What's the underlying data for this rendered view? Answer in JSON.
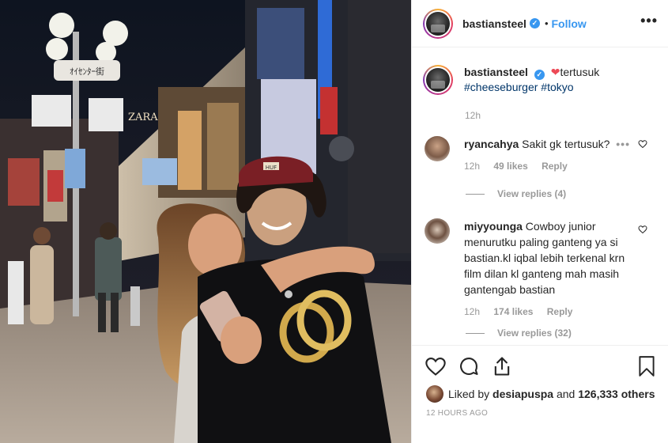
{
  "post": {
    "username": "bastiansteel",
    "verified_mark": "✓",
    "dot": "•",
    "follow_label": "Follow",
    "more_label": "•••"
  },
  "caption": {
    "username": "bastiansteel",
    "heart": "❤",
    "text": "tertusuk",
    "hashtag1": "#cheeseburger",
    "hashtag2": "#tokyo",
    "time": "12h"
  },
  "comments": [
    {
      "username": "ryancahya",
      "text": "Sakit gk tertusuk?",
      "time": "12h",
      "likes": "49 likes",
      "reply": "Reply",
      "view_replies": "View replies (4)"
    },
    {
      "username": "miyyounga",
      "text": "Cowboy junior menurutku paling ganteng ya si bastian.kl iqbal lebih terkenal krn film dilan kl ganteng mah masih gantengab bastian",
      "time": "12h",
      "likes": "174 likes",
      "reply": "Reply",
      "view_replies": "View replies (32)"
    }
  ],
  "footer": {
    "liked_prefix": "Liked by",
    "liked_user": "desiapuspa",
    "liked_and": "and",
    "liked_count": "126,333 others",
    "timestamp": "12 HOURS AGO"
  },
  "photo_signs": {
    "sign1": "ｵｲｾﾝﾀｰ街",
    "sign2": "ZARA",
    "sign3": "HUF",
    "sign4": "OLD"
  },
  "icons": {
    "like": "heart-icon",
    "comment": "comment-icon",
    "share": "share-icon",
    "save": "bookmark-icon"
  },
  "colors": {
    "link": "#3897f0",
    "hashtag": "#003569",
    "muted": "#999999",
    "heart": "#ed4956"
  }
}
